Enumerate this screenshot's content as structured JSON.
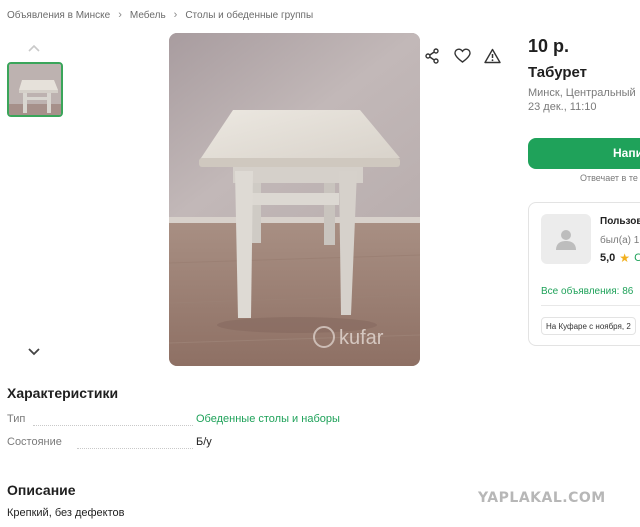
{
  "breadcrumb": [
    "Объявления в Минске",
    "Мебель",
    "Столы и обеденные группы"
  ],
  "listing": {
    "price": "10 р.",
    "title": "Табурет",
    "location": "Минск, Центральный",
    "date": "23 дек., 11:10",
    "write_button": "Напи",
    "reply_note": "Отвечает в те",
    "photo_watermark": "kufar"
  },
  "seller": {
    "name": "Пользов",
    "last_seen": "был(а) 1",
    "rating": "5,0",
    "rating_extra": "С",
    "all_ads": "Все объявления: 86",
    "since": "На Куфаре с ноября, 2"
  },
  "characteristics": {
    "heading": "Характеристики",
    "rows": [
      {
        "key": "Тип",
        "value": "Обеденные столы и наборы"
      },
      {
        "key": "Состояние",
        "value": "Б/у"
      }
    ]
  },
  "description": {
    "heading": "Описание",
    "text": "Крепкий, без дефектов"
  },
  "site_watermark": "YAPLAKAL.COM",
  "colors": {
    "accent": "#1fa25a",
    "star": "#f2b01e"
  },
  "icons": [
    "share-icon",
    "heart-icon",
    "warning-icon",
    "chevron-up-icon",
    "chevron-down-icon",
    "user-icon",
    "star-icon"
  ]
}
